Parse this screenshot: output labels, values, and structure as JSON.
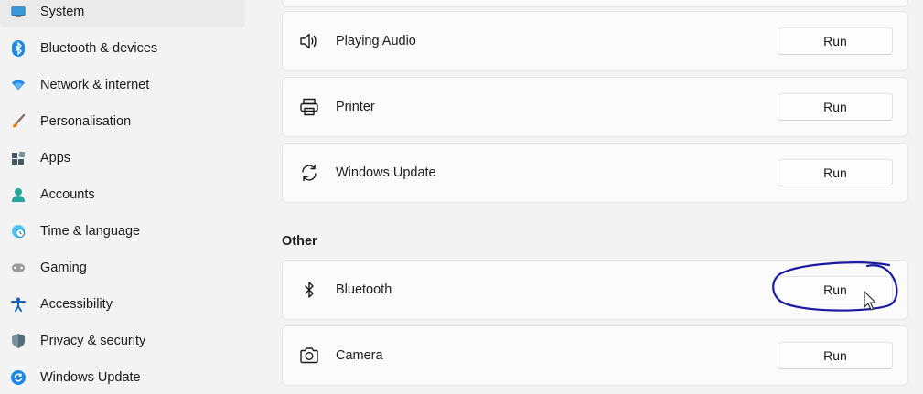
{
  "sidebar": {
    "items": [
      {
        "label": "System",
        "icon": "monitor-icon",
        "selected": true
      },
      {
        "label": "Bluetooth & devices",
        "icon": "bluetooth-devices-icon"
      },
      {
        "label": "Network & internet",
        "icon": "wifi-icon"
      },
      {
        "label": "Personalisation",
        "icon": "paintbrush-icon"
      },
      {
        "label": "Apps",
        "icon": "apps-icon"
      },
      {
        "label": "Accounts",
        "icon": "person-icon"
      },
      {
        "label": "Time & language",
        "icon": "globe-clock-icon"
      },
      {
        "label": "Gaming",
        "icon": "gamepad-icon"
      },
      {
        "label": "Accessibility",
        "icon": "accessibility-icon"
      },
      {
        "label": "Privacy & security",
        "icon": "shield-icon"
      },
      {
        "label": "Windows Update",
        "icon": "refresh-icon"
      }
    ]
  },
  "troubleshooters": {
    "items": [
      {
        "label": "Playing Audio",
        "icon": "speaker-icon",
        "button": "Run"
      },
      {
        "label": "Printer",
        "icon": "printer-icon",
        "button": "Run"
      },
      {
        "label": "Windows Update",
        "icon": "sync-icon",
        "button": "Run"
      }
    ]
  },
  "other": {
    "header": "Other",
    "items": [
      {
        "label": "Bluetooth",
        "icon": "bluetooth-icon",
        "button": "Run"
      },
      {
        "label": "Camera",
        "icon": "camera-icon",
        "button": "Run"
      }
    ]
  },
  "colors": {
    "accent_blue": "#0067c0",
    "annotation_ink": "#1a1aa0"
  }
}
